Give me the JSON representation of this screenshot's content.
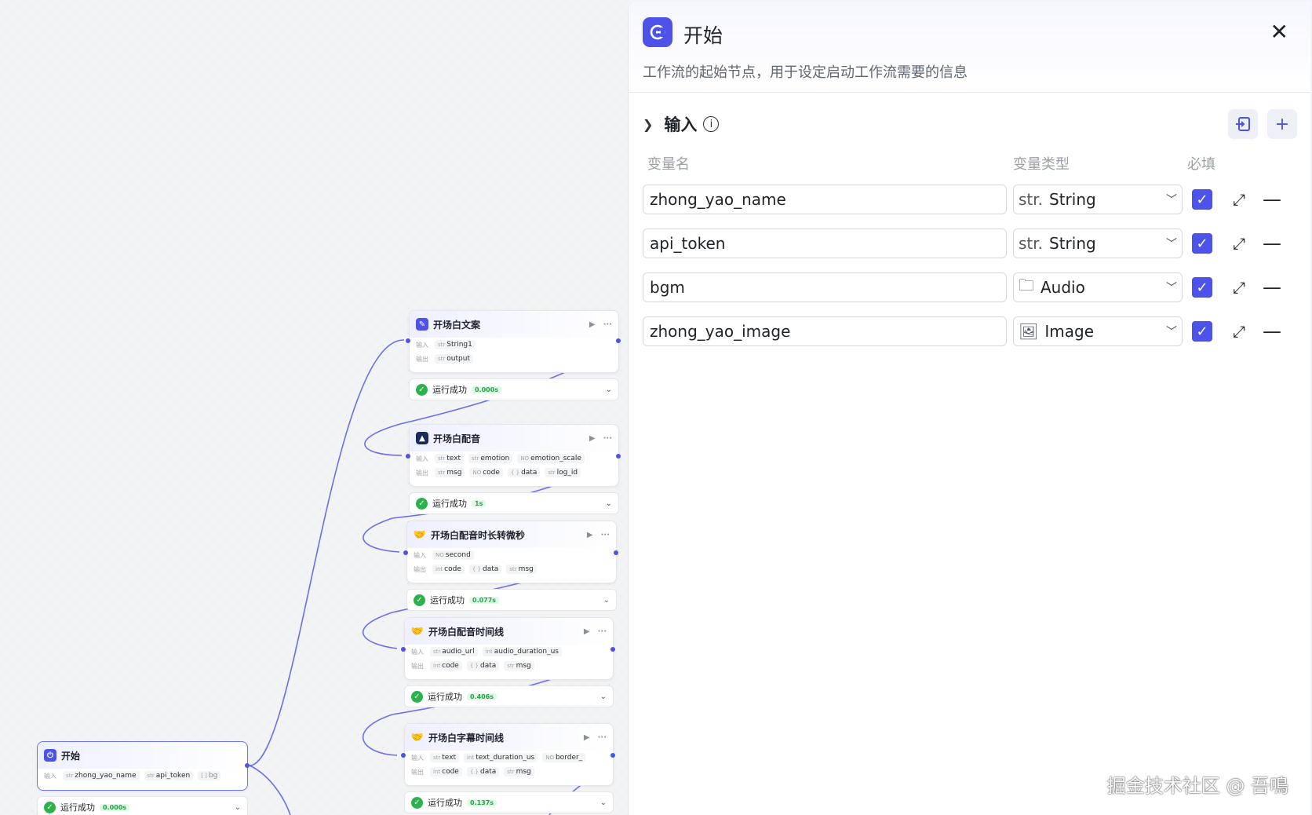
{
  "canvas": {
    "nodes": [
      {
        "title": "开场白文案",
        "icon": "text-node-icon",
        "input_label": "输入",
        "output_label": "输出",
        "inputs": [
          {
            "t": "str",
            "n": "String1"
          }
        ],
        "outputs": [
          {
            "t": "str",
            "n": "output"
          }
        ],
        "status": "运行成功",
        "time": "0.000s"
      },
      {
        "title": "开场白配音",
        "icon": "audio-plugin-icon",
        "input_label": "输入",
        "output_label": "输出",
        "inputs": [
          {
            "t": "str",
            "n": "text"
          },
          {
            "t": "str",
            "n": "emotion"
          },
          {
            "t": "NO",
            "n": "emotion_scale"
          }
        ],
        "outputs": [
          {
            "t": "str",
            "n": "msg"
          },
          {
            "t": "NO",
            "n": "code"
          },
          {
            "t": "{ }",
            "n": "data"
          },
          {
            "t": "str",
            "n": "log_id"
          }
        ],
        "status": "运行成功",
        "time": "1s"
      },
      {
        "title": "开场白配音时长转微秒",
        "icon": "handshake-icon",
        "input_label": "输入",
        "output_label": "输出",
        "inputs": [
          {
            "t": "NO",
            "n": "second"
          }
        ],
        "outputs": [
          {
            "t": "int",
            "n": "code"
          },
          {
            "t": "{ }",
            "n": "data"
          },
          {
            "t": "str",
            "n": "msg"
          }
        ],
        "status": "运行成功",
        "time": "0.077s"
      },
      {
        "title": "开场白配音时间线",
        "icon": "handshake-icon",
        "input_label": "输入",
        "output_label": "输出",
        "inputs": [
          {
            "t": "str",
            "n": "audio_url"
          },
          {
            "t": "int",
            "n": "audio_duration_us"
          }
        ],
        "outputs": [
          {
            "t": "int",
            "n": "code"
          },
          {
            "t": "{ }",
            "n": "data"
          },
          {
            "t": "str",
            "n": "msg"
          }
        ],
        "status": "运行成功",
        "time": "0.406s"
      },
      {
        "title": "开场白字幕时间线",
        "icon": "handshake-icon",
        "input_label": "输入",
        "output_label": "输出",
        "inputs": [
          {
            "t": "str",
            "n": "text"
          },
          {
            "t": "int",
            "n": "text_duration_us"
          },
          {
            "t": "NO",
            "n": "border_"
          }
        ],
        "outputs": [
          {
            "t": "int",
            "n": "code"
          },
          {
            "t": "{ }",
            "n": "data"
          },
          {
            "t": "str",
            "n": "msg"
          }
        ],
        "status": "运行成功",
        "time": "0.137s"
      },
      {
        "title": "开始",
        "icon": "start-node-icon",
        "input_label": "输入",
        "output_label": "",
        "inputs": [
          {
            "t": "str",
            "n": "zhong_yao_name"
          },
          {
            "t": "str",
            "n": "api_token"
          },
          {
            "t": "[ ]",
            "n": "bg"
          }
        ],
        "outputs": [],
        "status": "运行成功",
        "time": "0.000s"
      }
    ]
  },
  "panel": {
    "title": "开始",
    "description": "工作流的起始节点，用于设定启动工作流需要的信息",
    "section_title": "输入",
    "col_name": "变量名",
    "col_type": "变量类型",
    "col_required": "必填",
    "rows": [
      {
        "name": "zhong_yao_name",
        "type_icon": "str.",
        "type": "String"
      },
      {
        "name": "api_token",
        "type_icon": "str.",
        "type": "String"
      },
      {
        "name": "bgm",
        "type_icon": "🗀",
        "type": "Audio"
      },
      {
        "name": "zhong_yao_image",
        "type_icon": "🖼",
        "type": "Image"
      }
    ]
  },
  "watermark": "掘金技术社区 @ 吾鳴",
  "colors": {
    "accent": "#4d53e8",
    "success": "#2bb24c"
  }
}
